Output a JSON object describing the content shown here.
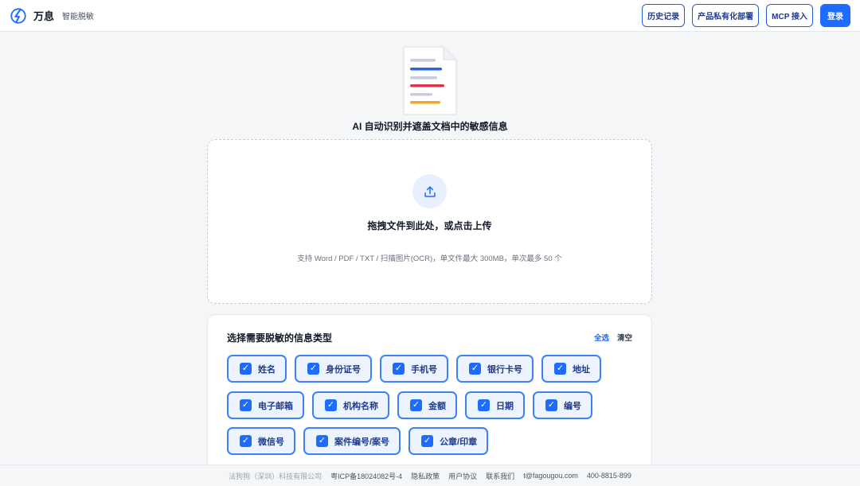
{
  "header": {
    "brand_name": "万息",
    "brand_sub": "智能脱敏",
    "nav": {
      "history": "历史记录",
      "private_deploy": "产品私有化部署",
      "mcp": "MCP 接入",
      "login": "登录"
    }
  },
  "hero": {
    "title": "AI 自动识别并遮盖文档中的敏感信息"
  },
  "dropzone": {
    "main_text": "拖拽文件到此处，或点击上传",
    "hint": "支持 Word / PDF / TXT / 扫描图片(OCR)，单文件最大 300MB，单次最多 50 个"
  },
  "types": {
    "title": "选择需要脱敏的信息类型",
    "select_all": "全选",
    "clear": "清空",
    "check_mark": "✓",
    "row1": [
      "姓名",
      "身份证号",
      "手机号",
      "银行卡号",
      "地址"
    ],
    "row2": [
      "电子邮箱",
      "机构名称",
      "金额",
      "日期",
      "编号"
    ],
    "row3": [
      "微信号",
      "案件编号/案号",
      "公章/印章"
    ]
  },
  "footer": {
    "company": "法狗狗（深圳）科技有限公司",
    "icp": "粤ICP备18024082号-4",
    "privacy": "隐私政策",
    "agreement": "用户协议",
    "contact": "联系我们",
    "email": "t@fagougou.com",
    "phone": "400-8815-899"
  },
  "colors": {
    "primary": "#1e6bff",
    "chip_border": "#3b82f6",
    "chip_bg": "#eef4ff"
  }
}
